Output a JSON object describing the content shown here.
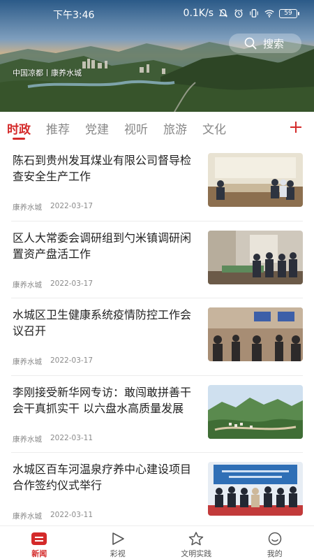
{
  "status_bar": {
    "time": "下午3:46",
    "network_speed": "0.1K/s",
    "battery": "59",
    "icons": [
      "mute-icon",
      "alarm-icon",
      "vibrate-icon",
      "wifi-icon",
      "battery-icon"
    ]
  },
  "header": {
    "caption": "中国凉都丨康养水城",
    "search_label": "搜索",
    "search_icon": "search-icon"
  },
  "tabs": [
    {
      "label": "时政",
      "active": true
    },
    {
      "label": "推荐",
      "active": false
    },
    {
      "label": "党建",
      "active": false
    },
    {
      "label": "视听",
      "active": false
    },
    {
      "label": "旅游",
      "active": false
    },
    {
      "label": "文化",
      "active": false
    }
  ],
  "add_tab_icon": "plus-icon",
  "news": [
    {
      "title": "陈石到贵州发耳煤业有限公司督导检查安全生产工作",
      "source": "康养水城",
      "date": "2022-03-17"
    },
    {
      "title": "区人大常委会调研组到勺米镇调研闲置资产盘活工作",
      "source": "康养水城",
      "date": "2022-03-17"
    },
    {
      "title": "水城区卫生健康系统疫情防控工作会议召开",
      "source": "康养水城",
      "date": "2022-03-17"
    },
    {
      "title": "李刚接受新华网专访：敢闯敢拼善干会干真抓实干 以六盘水高质量发展",
      "source": "康养水城",
      "date": "2022-03-11"
    },
    {
      "title": "水城区百车河温泉疗养中心建设项目合作签约仪式举行",
      "source": "康养水城",
      "date": "2022-03-11"
    }
  ],
  "bottom_nav": [
    {
      "label": "新闻",
      "icon": "news-icon",
      "active": true
    },
    {
      "label": "彩视",
      "icon": "play-icon",
      "active": false
    },
    {
      "label": "文明实践",
      "icon": "star-icon",
      "active": false
    },
    {
      "label": "我的",
      "icon": "smile-icon",
      "active": false
    }
  ],
  "colors": {
    "accent": "#d42a2a",
    "muted_text": "#8a8a8a",
    "tab_inactive": "#888888"
  }
}
